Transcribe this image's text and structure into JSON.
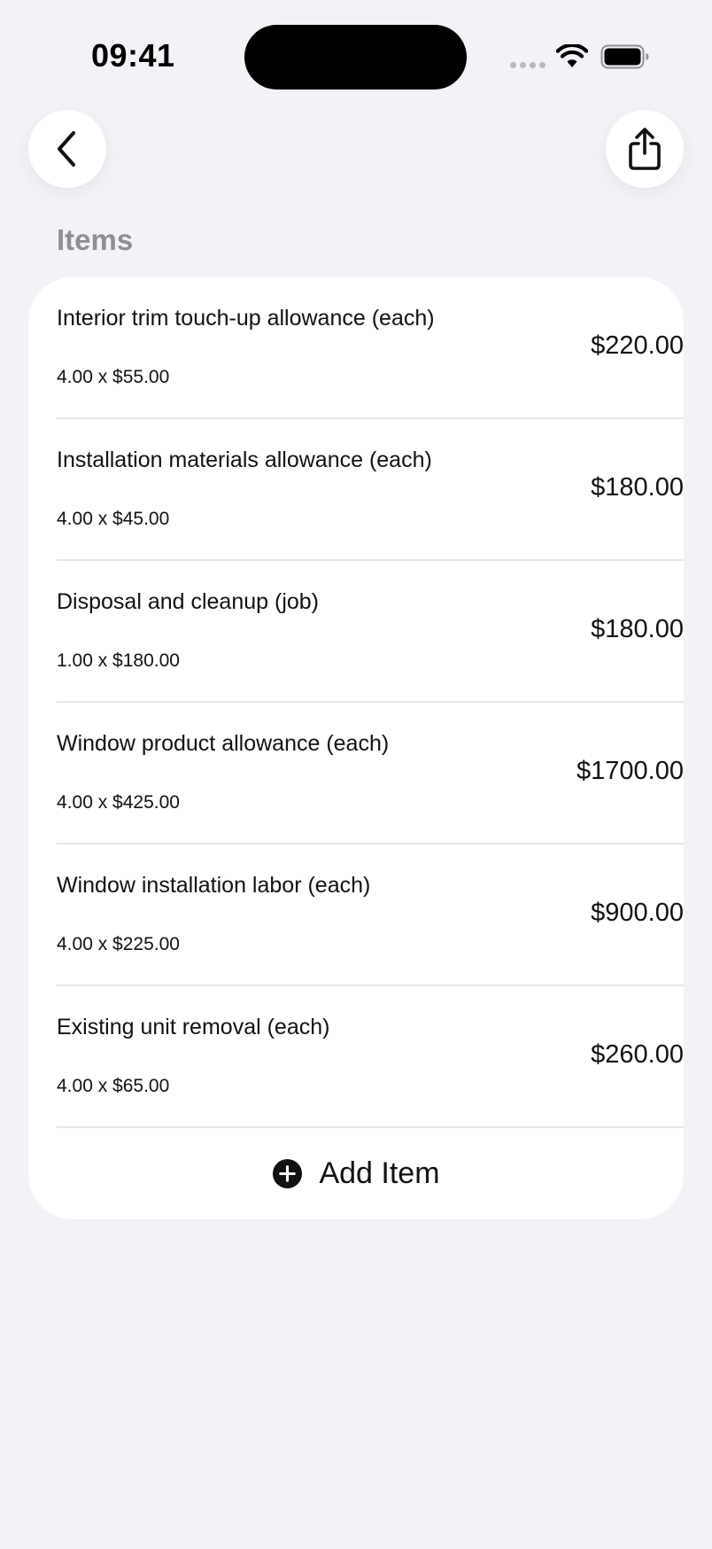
{
  "status_bar": {
    "time": "09:41"
  },
  "nav": {
    "back_icon": "chevron-left-icon",
    "share_icon": "share-icon"
  },
  "section": {
    "title": "Items"
  },
  "items": [
    {
      "name": "Interior trim touch-up allowance (each)",
      "qty": "4.00 x $55.00",
      "total": "$220.00"
    },
    {
      "name": "Installation materials allowance (each)",
      "qty": "4.00 x $45.00",
      "total": "$180.00"
    },
    {
      "name": "Disposal and cleanup (job)",
      "qty": "1.00 x $180.00",
      "total": "$180.00"
    },
    {
      "name": "Window product allowance (each)",
      "qty": "4.00 x $425.00",
      "total": "$1700.00"
    },
    {
      "name": "Window installation labor (each)",
      "qty": "4.00 x $225.00",
      "total": "$900.00"
    },
    {
      "name": "Existing unit removal (each)",
      "qty": "4.00 x $65.00",
      "total": "$260.00"
    }
  ],
  "add_item": {
    "label": "Add Item",
    "icon": "plus-circle-icon"
  },
  "colors": {
    "background": "#f2f2f7",
    "card": "#ffffff",
    "section_title": "#8e8e93",
    "divider": "#e5e5ea"
  }
}
